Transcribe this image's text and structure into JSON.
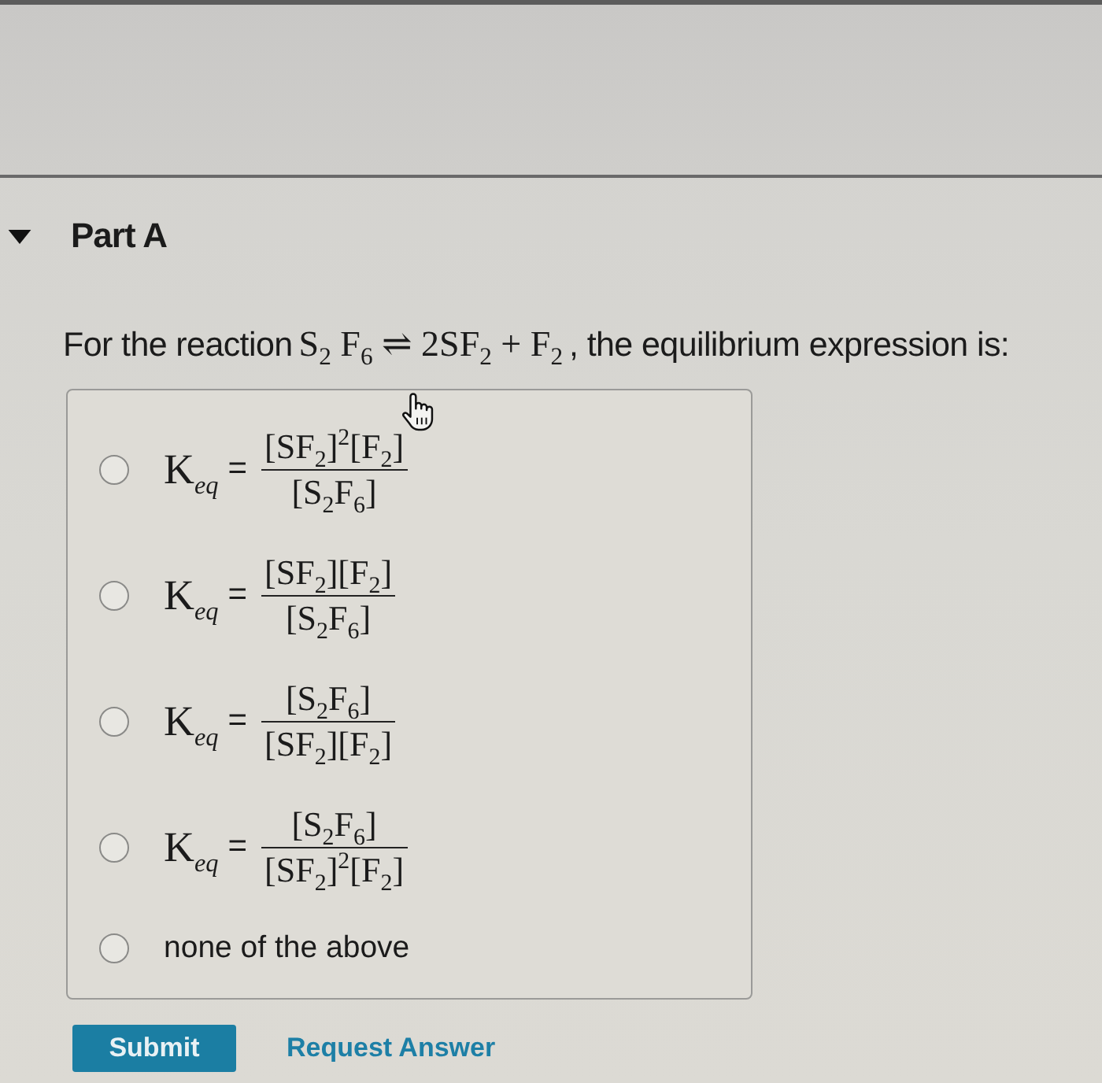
{
  "section": {
    "title": "Part A",
    "expanded": true
  },
  "prompt": {
    "before": "For the reaction",
    "equation": "S$_{2}$ F$_{6}$ ⇌ 2SF$_{2}$ + F$_{2}$",
    "after": ", the equilibrium expression is:"
  },
  "options": [
    {
      "kind": "fraction",
      "selected": false,
      "lhs": "K$_{eq}$",
      "relation": "=",
      "numerator": "[SF$_{2}$]$^{2}$[F$_{2}$]",
      "denominator": "[S$_{2}$F$_{6}$]"
    },
    {
      "kind": "fraction",
      "selected": false,
      "lhs": "K$_{eq}$",
      "relation": "=",
      "numerator": "[SF$_{2}$][F$_{2}$]",
      "denominator": "[S$_{2}$F$_{6}$]"
    },
    {
      "kind": "fraction",
      "selected": false,
      "lhs": "K$_{eq}$",
      "relation": "=",
      "numerator": "[S$_{2}$F$_{6}$]",
      "denominator": "[SF$_{2}$][F$_{2}$]"
    },
    {
      "kind": "fraction",
      "selected": false,
      "lhs": "K$_{eq}$",
      "relation": "=",
      "numerator": "[S$_{2}$F$_{6}$]",
      "denominator": "[SF$_{2}$]$^{2}$[F$_{2}$]"
    },
    {
      "kind": "text",
      "selected": false,
      "label": "none of the above"
    }
  ],
  "buttons": [
    {
      "kind": "primary",
      "label": "Submit"
    },
    {
      "kind": "link",
      "label": "Request Answer"
    }
  ]
}
